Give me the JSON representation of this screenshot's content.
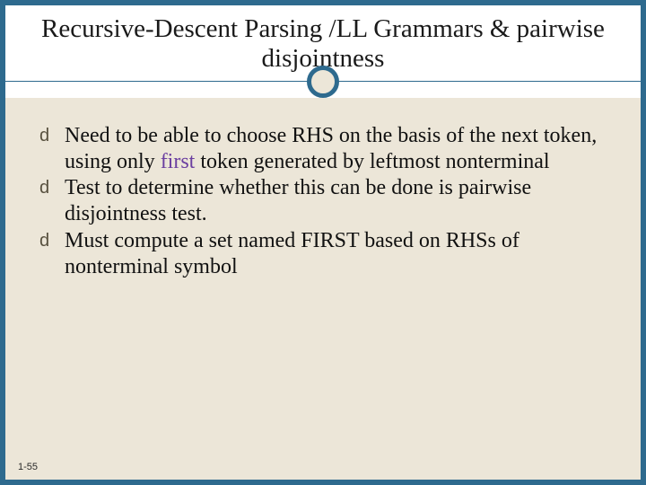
{
  "title": "Recursive-Descent Parsing /LL Grammars & pairwise disjointness",
  "bullets": [
    {
      "lead": "Need to be able to choose RHS on the basis of the next token, using only ",
      "accent": "first",
      "tail": " token generated by leftmost nonterminal"
    },
    {
      "lead": "Test to determine whether this can be done is pairwise disjointness test.",
      "accent": "",
      "tail": ""
    },
    {
      "lead": "Must compute a set named FIRST based on RHSs of nonterminal symbol",
      "accent": "",
      "tail": ""
    }
  ],
  "bullet_glyph": "d",
  "page_number": "1-55"
}
